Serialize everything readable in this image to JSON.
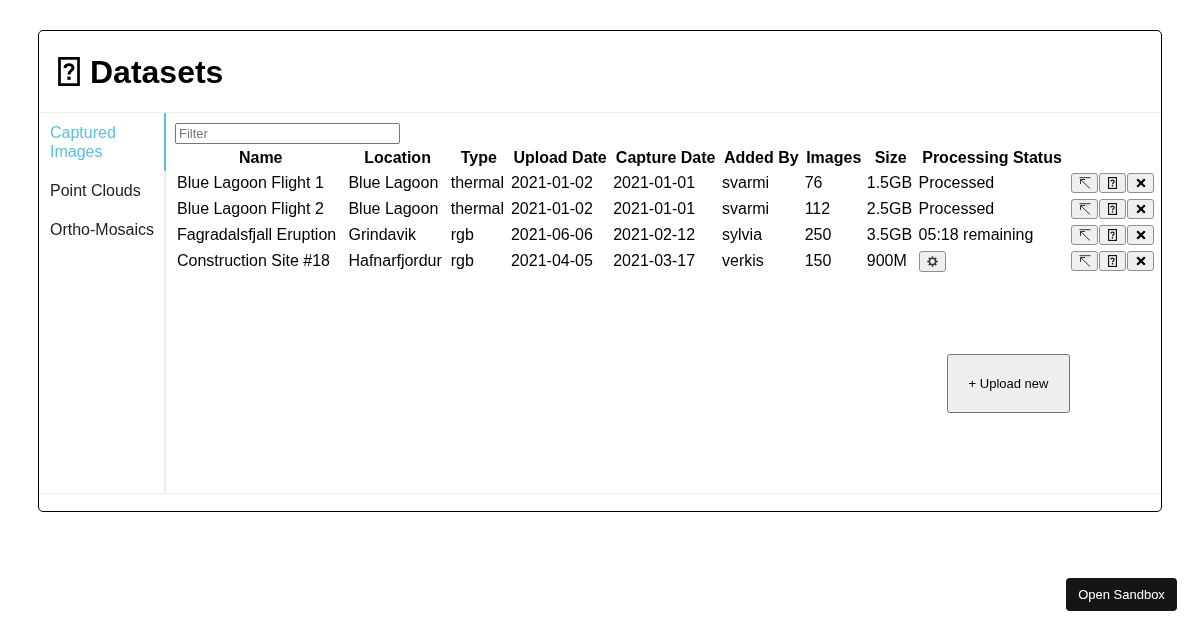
{
  "header": {
    "title": "Datasets"
  },
  "sidebar": {
    "items": [
      {
        "label": "Captured Images",
        "selected": true
      },
      {
        "label": "Point Clouds",
        "selected": false
      },
      {
        "label": "Ortho-Mosaics",
        "selected": false
      }
    ]
  },
  "filter": {
    "placeholder": "Filter"
  },
  "table": {
    "columns": [
      "Name",
      "Location",
      "Type",
      "Upload Date",
      "Capture Date",
      "Added By",
      "Images",
      "Size",
      "Processing Status"
    ],
    "rows": [
      {
        "cells": [
          "Blue Lagoon Flight 1",
          "Blue Lagoon",
          "thermal",
          "2021-01-02",
          "2021-01-01",
          "svarmi",
          "76",
          "1.5GB"
        ],
        "status": {
          "kind": "text",
          "text": "Processed"
        }
      },
      {
        "cells": [
          "Blue Lagoon Flight 2",
          "Blue Lagoon",
          "thermal",
          "2021-01-02",
          "2021-01-01",
          "svarmi",
          "112",
          "2.5GB"
        ],
        "status": {
          "kind": "text",
          "text": "Processed"
        }
      },
      {
        "cells": [
          "Fagradalsfjall Eruption",
          "Grindavik",
          "rgb",
          "2021-06-06",
          "2021-02-12",
          "sylvia",
          "250",
          "3.5GB"
        ],
        "status": {
          "kind": "text",
          "text": "05:18 remaining"
        }
      },
      {
        "cells": [
          "Construction Site #18",
          "Hafnarfjordur",
          "rgb",
          "2021-04-05",
          "2021-03-17",
          "verkis",
          "150",
          "900M"
        ],
        "status": {
          "kind": "gear_button"
        }
      }
    ]
  },
  "upload_button": {
    "label": "+ Upload new"
  },
  "sandbox_button": {
    "label": "Open Sandbox"
  }
}
